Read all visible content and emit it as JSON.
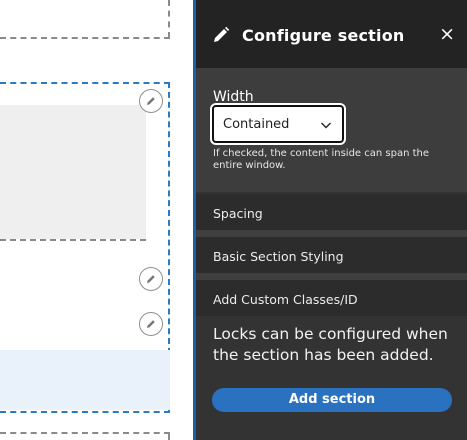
{
  "panel": {
    "title": "Configure section",
    "close_label": "×",
    "width": {
      "label": "Width",
      "selected": "Contained",
      "help": "If checked, the content inside can span the entire window."
    },
    "sections": [
      {
        "label": "Spacing"
      },
      {
        "label": "Basic Section Styling"
      },
      {
        "label": "Add Custom Classes/ID"
      }
    ],
    "locks_note": "Locks can be configured when the section has been added.",
    "add_section_label": "Add section"
  },
  "colors": {
    "panel_bg": "#333333",
    "header_bg": "#232323",
    "accent": "#2a72bf",
    "canvas_dash_blue": "#2a7bc4"
  },
  "icons": [
    "pencil-icon",
    "close-icon",
    "chevron-down-icon",
    "edit-circle-icon"
  ]
}
